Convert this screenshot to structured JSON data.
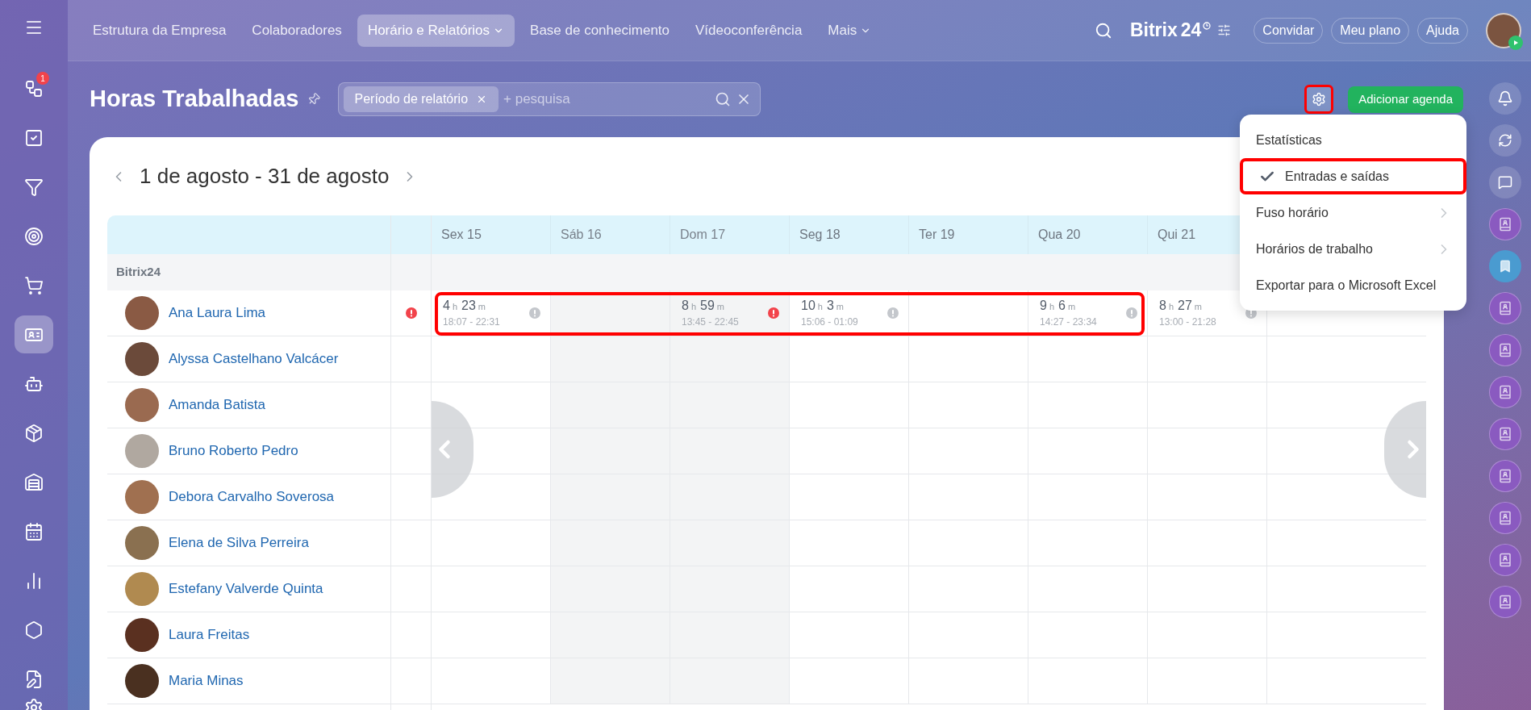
{
  "sidebar": {
    "items": [
      {
        "selected": false,
        "badge": "1"
      },
      {
        "selected": false
      },
      {
        "selected": false
      },
      {
        "selected": false
      },
      {
        "selected": false
      },
      {
        "selected": true
      },
      {
        "selected": false
      },
      {
        "selected": false
      },
      {
        "selected": false
      },
      {
        "selected": false
      },
      {
        "selected": false
      },
      {
        "selected": false
      },
      {
        "selected": false
      }
    ]
  },
  "top_nav": {
    "items": [
      {
        "label": "Estrutura da Empresa",
        "selected": false,
        "dropdown": false
      },
      {
        "label": "Colaboradores",
        "selected": false,
        "dropdown": false
      },
      {
        "label": "Horário e Relatórios",
        "selected": true,
        "dropdown": true
      },
      {
        "label": "Base de conhecimento",
        "selected": false,
        "dropdown": false
      },
      {
        "label": "Vídeoconferência",
        "selected": false,
        "dropdown": false
      },
      {
        "label": "Mais",
        "selected": false,
        "dropdown": true
      }
    ],
    "logo": {
      "name": "Bitrix",
      "number": "24"
    },
    "buttons": [
      "Convidar",
      "Meu plano",
      "Ajuda"
    ]
  },
  "page": {
    "title": "Horas Trabalhadas",
    "filter": {
      "chip": "Período de relatório",
      "placeholder": "+ pesquisa"
    },
    "add_button": "Adicionar agenda"
  },
  "settings_menu": {
    "items": [
      {
        "label": "Estatísticas",
        "checked": false,
        "submenu": false
      },
      {
        "label": "Entradas e saídas",
        "checked": true,
        "submenu": false
      },
      {
        "label": "Fuso horário",
        "checked": false,
        "submenu": true
      },
      {
        "label": "Horários de trabalho",
        "checked": false,
        "submenu": true
      },
      {
        "label": "Exportar para o Microsoft Excel",
        "checked": false,
        "submenu": false
      }
    ]
  },
  "report": {
    "period": "1 de agosto - 31 de agosto",
    "columns": [
      {
        "label": "Sex 15",
        "weekend": false
      },
      {
        "label": "Sáb 16",
        "weekend": true
      },
      {
        "label": "Dom 17",
        "weekend": true
      },
      {
        "label": "Seg 18",
        "weekend": false
      },
      {
        "label": "Ter 19",
        "weekend": false
      },
      {
        "label": "Qua 20",
        "weekend": false
      },
      {
        "label": "Qui 21",
        "weekend": false
      }
    ],
    "group": "Bitrix24",
    "employees": [
      {
        "name": "Ana Laura Lima",
        "alert": true,
        "cells": [
          {
            "duration": [
              {
                "value": "4",
                "unit": "h"
              },
              {
                "value": "23",
                "unit": "m"
              }
            ],
            "range": "18:07 - 22:31",
            "error": false
          },
          null,
          {
            "duration": [
              {
                "value": "8",
                "unit": "h"
              },
              {
                "value": "59",
                "unit": "m"
              }
            ],
            "range": "13:45 - 22:45",
            "error": true
          },
          {
            "duration": [
              {
                "value": "10",
                "unit": "h"
              },
              {
                "value": "3",
                "unit": "m"
              }
            ],
            "range": "15:06 - 01:09",
            "error": false
          },
          null,
          {
            "duration": [
              {
                "value": "9",
                "unit": "h"
              },
              {
                "value": "6",
                "unit": "m"
              }
            ],
            "range": "14:27 - 23:34",
            "error": false
          },
          {
            "duration": [
              {
                "value": "8",
                "unit": "h"
              },
              {
                "value": "27",
                "unit": "m"
              }
            ],
            "range": "13:00 - 21:28",
            "error": false
          }
        ]
      },
      {
        "name": "Alyssa Castelhano Valcácer"
      },
      {
        "name": "Amanda Batista"
      },
      {
        "name": "Bruno Roberto Pedro"
      },
      {
        "name": "Debora Carvalho Soverosa"
      },
      {
        "name": "Elena de Silva Perreira"
      },
      {
        "name": "Estefany Valverde Quinta"
      },
      {
        "name": "Laura Freitas"
      },
      {
        "name": "Maria Minas"
      }
    ]
  }
}
